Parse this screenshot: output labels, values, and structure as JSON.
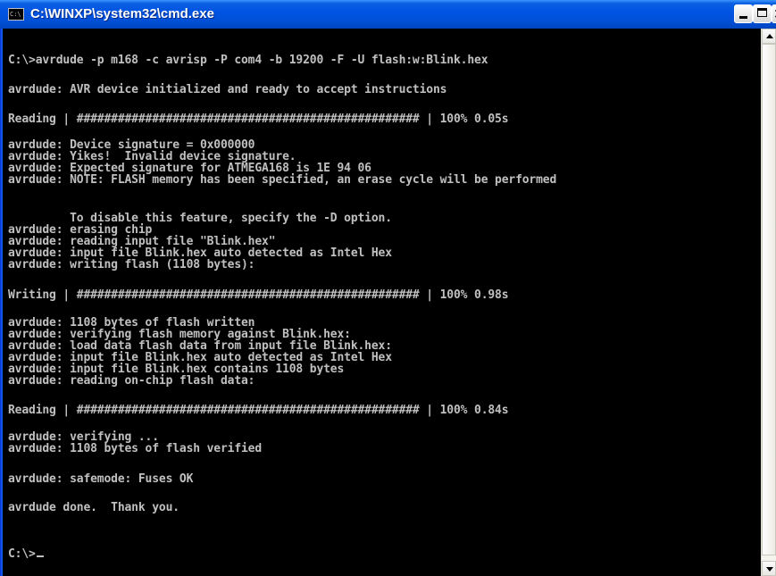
{
  "window": {
    "title": "C:\\WINXP\\system32\\cmd.exe",
    "icon_label": "C:\\"
  },
  "console": {
    "lines": [
      "C:\\>avrdude -p m168 -c avrisp -P com4 -b 19200 -F -U flash:w:Blink.hex",
      "avrdude: AVR device initialized and ready to accept instructions",
      "Reading | ################################################## | 100% 0.05s",
      "avrdude: Device signature = 0x000000",
      "avrdude: Yikes!  Invalid device signature.",
      "avrdude: Expected signature for ATMEGA168 is 1E 94 06",
      "avrdude: NOTE: FLASH memory has been specified, an erase cycle will be performed",
      "         To disable this feature, specify the -D option.",
      "avrdude: erasing chip",
      "avrdude: reading input file \"Blink.hex\"",
      "avrdude: input file Blink.hex auto detected as Intel Hex",
      "avrdude: writing flash (1108 bytes):",
      "Writing | ################################################## | 100% 0.98s",
      "avrdude: 1108 bytes of flash written",
      "avrdude: verifying flash memory against Blink.hex:",
      "avrdude: load data flash data from input file Blink.hex:",
      "avrdude: input file Blink.hex auto detected as Intel Hex",
      "avrdude: input file Blink.hex contains 1108 bytes",
      "avrdude: reading on-chip flash data:",
      "Reading | ################################################## | 100% 0.84s",
      "avrdude: verifying ...",
      "avrdude: 1108 bytes of flash verified",
      "avrdude: safemode: Fuses OK",
      "avrdude done.  Thank you.",
      "C:\\>"
    ]
  },
  "colors": {
    "console_background": "#000000",
    "console_text": "#c0c0c0",
    "titlebar": "#0054e3"
  }
}
